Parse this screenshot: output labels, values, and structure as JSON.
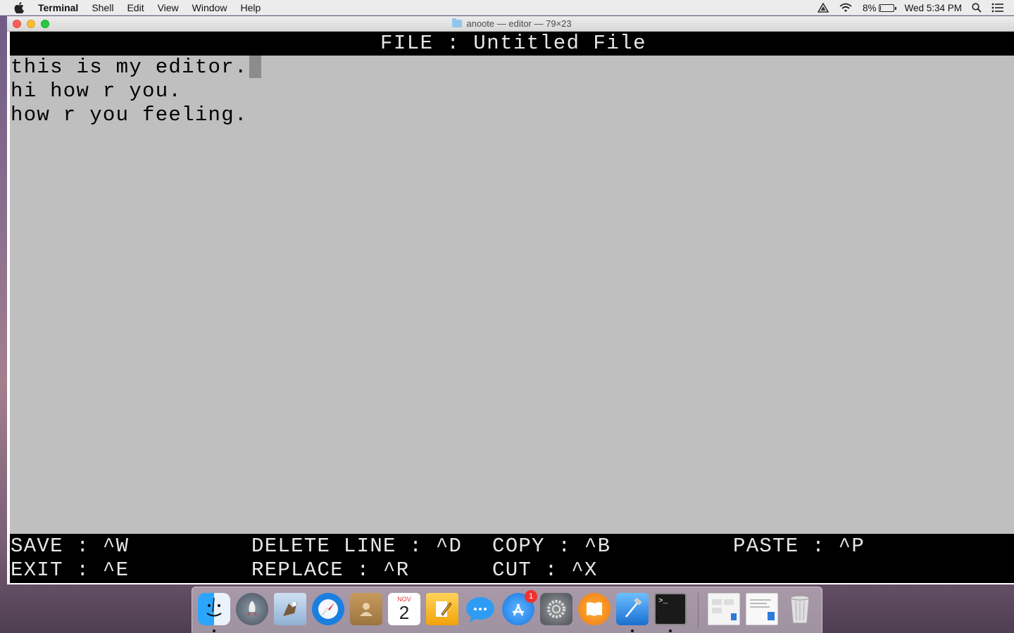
{
  "menubar": {
    "app_name": "Terminal",
    "items": [
      "Shell",
      "Edit",
      "View",
      "Window",
      "Help"
    ],
    "battery_percent": "8%",
    "battery_level": 0.08,
    "clock": "Wed 5:34 PM"
  },
  "window": {
    "title": "anoote — editor — 79×23"
  },
  "editor": {
    "header": "FILE : Untitled File",
    "lines": [
      "this is my editor.",
      "hi how r you.",
      "how r you feeling."
    ],
    "shortcuts": [
      {
        "label": "SAVE : ^W"
      },
      {
        "label": "DELETE LINE : ^D"
      },
      {
        "label": "COPY : ^B"
      },
      {
        "label": "PASTE : ^P"
      },
      {
        "label": "EXIT : ^E"
      },
      {
        "label": "REPLACE : ^R"
      },
      {
        "label": "CUT : ^X"
      }
    ]
  },
  "dock": {
    "calendar_month": "NOV",
    "calendar_day": "2",
    "app_store_badge": "1",
    "items": [
      "finder-icon",
      "launchpad-icon",
      "mail-icon",
      "safari-icon",
      "contacts-icon",
      "calendar-icon",
      "pages-icon",
      "messages-icon",
      "app-store-icon",
      "system-preferences-icon",
      "ibooks-icon",
      "xcode-icon",
      "terminal-icon",
      "downloads-stack-icon",
      "documents-stack-icon",
      "trash-icon"
    ]
  }
}
